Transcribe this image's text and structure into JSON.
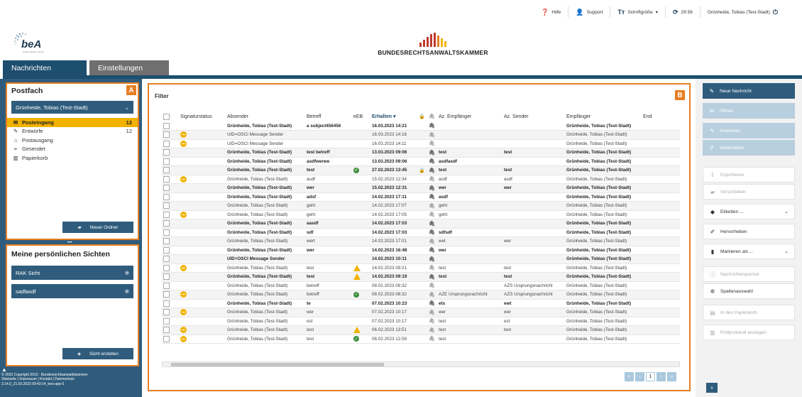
{
  "topbar": {
    "help": "Hilfe",
    "support": "Support",
    "font_size": "Schriftgröße",
    "timer": "29:56",
    "user": "Grünheide, Tobias (Test-Stadt)"
  },
  "logo": {
    "bea": "beA",
    "bea_tagline": "Digital. Einfach. Sicher.",
    "brak": "BUNDESRECHTSANWALTSKAMMER"
  },
  "tabs": [
    {
      "label": "Nachrichten"
    },
    {
      "label": "Einstellungen"
    }
  ],
  "postfach": {
    "title": "Postfach",
    "badge": "A",
    "account": "Grünheide, Tobias (Test-Stadt)",
    "folders": [
      {
        "label": "Posteingang",
        "count": "12",
        "icon": "inbox-icon"
      },
      {
        "label": "Entwürfe",
        "count": "12",
        "icon": "draft-icon"
      },
      {
        "label": "Postausgang",
        "count": "",
        "icon": "outbox-icon"
      },
      {
        "label": "Gesendet",
        "count": "",
        "icon": "sent-icon"
      },
      {
        "label": "Papierkorb",
        "count": "",
        "icon": "trash-icon"
      }
    ],
    "new_folder": "Neuer Ordner"
  },
  "views": {
    "title": "Meine persönlichen Sichten",
    "items": [
      {
        "label": "RAK Sicht"
      },
      {
        "label": "sadfasdf"
      }
    ],
    "create": "Sicht erstellen"
  },
  "footer": {
    "copyright": "© 2023 Copyright 2015 - Bundesrechtsanwaltskammer",
    "links": "Startseite | Impressum | Kontakt | Datenschutz",
    "version": "3.14.0_21.03.2023 09:43:14_bea-app-0"
  },
  "main": {
    "filter": "Filter",
    "badge": "B",
    "columns": [
      "Signaturstatus",
      "Absender",
      "Betreff",
      "eEB",
      "Erhalten",
      "Az. Empfänger",
      "Az. Sender",
      "Empfänger",
      "End"
    ],
    "rows": [
      {
        "status": "",
        "sender": "Grünheide, Tobias (Test-Stadt)",
        "subject": "a subject456456",
        "eeb": "",
        "received": "16.03.2023 14:21",
        "lock": false,
        "az_emp": "",
        "az_snd": "",
        "recipient": "Grünheide, Tobias (Test-Stadt)",
        "unread": true
      },
      {
        "status": "dot",
        "sender": "UID=OSCI Message Sender",
        "subject": "",
        "eeb": "",
        "received": "16.03.2023 14:16",
        "lock": false,
        "az_emp": "",
        "az_snd": "",
        "recipient": "Grünheide, Tobias (Test-Stadt)",
        "unread": false
      },
      {
        "status": "dot",
        "sender": "UID=OSCI Message Sender",
        "subject": "",
        "eeb": "",
        "received": "16.03.2023 14:11",
        "lock": false,
        "az_emp": "",
        "az_snd": "",
        "recipient": "Grünheide, Tobias (Test-Stadt)",
        "unread": false
      },
      {
        "status": "",
        "sender": "Grünheide, Tobias (Test-Stadt)",
        "subject": "test betreff",
        "eeb": "",
        "received": "13.03.2023 09:06",
        "lock": false,
        "az_emp": "test",
        "az_snd": "test",
        "recipient": "Grünheide, Tobias (Test-Stadt)",
        "unread": true
      },
      {
        "status": "",
        "sender": "Grünheide, Tobias (Test-Stadt)",
        "subject": "asdfwerwe",
        "eeb": "",
        "received": "13.03.2023 09:06",
        "lock": false,
        "az_emp": "asdfasdf",
        "az_snd": "",
        "recipient": "Grünheide, Tobias (Test-Stadt)",
        "unread": true
      },
      {
        "status": "",
        "sender": "Grünheide, Tobias (Test-Stadt)",
        "subject": "test",
        "eeb": "ok",
        "received": "27.02.2023 13:45",
        "lock": true,
        "az_emp": "test",
        "az_snd": "test",
        "recipient": "Grünheide, Tobias (Test-Stadt)",
        "unread": true
      },
      {
        "status": "dot",
        "sender": "Grünheide, Tobias (Test-Stadt)",
        "subject": "asdf",
        "eeb": "",
        "received": "15.02.2023 12:34",
        "lock": false,
        "az_emp": "asdf",
        "az_snd": "asdf",
        "recipient": "Grünheide, Tobias (Test-Stadt)",
        "unread": false
      },
      {
        "status": "",
        "sender": "Grünheide, Tobias (Test-Stadt)",
        "subject": "wer",
        "eeb": "",
        "received": "15.02.2023 12:31",
        "lock": false,
        "az_emp": "wer",
        "az_snd": "wer",
        "recipient": "Grünheide, Tobias (Test-Stadt)",
        "unread": true
      },
      {
        "status": "",
        "sender": "Grünheide, Tobias (Test-Stadt)",
        "subject": "adsf",
        "eeb": "",
        "received": "14.02.2023 17:11",
        "lock": false,
        "az_emp": "asdf",
        "az_snd": "",
        "recipient": "Grünheide, Tobias (Test-Stadt)",
        "unread": true
      },
      {
        "status": "",
        "sender": "Grünheide, Tobias (Test-Stadt)",
        "subject": "geht",
        "eeb": "",
        "received": "14.02.2023 17:07",
        "lock": false,
        "az_emp": "geht",
        "az_snd": "",
        "recipient": "Grünheide, Tobias (Test-Stadt)",
        "unread": false
      },
      {
        "status": "dot",
        "sender": "Grünheide, Tobias (Test-Stadt)",
        "subject": "geht",
        "eeb": "",
        "received": "14.02.2023 17:05",
        "lock": false,
        "az_emp": "geht",
        "az_snd": "",
        "recipient": "Grünheide, Tobias (Test-Stadt)",
        "unread": false
      },
      {
        "status": "",
        "sender": "Grünheide, Tobias (Test-Stadt)",
        "subject": "aasdf",
        "eeb": "",
        "received": "14.02.2023 17:03",
        "lock": false,
        "az_emp": "",
        "az_snd": "",
        "recipient": "Grünheide, Tobias (Test-Stadt)",
        "unread": true
      },
      {
        "status": "",
        "sender": "Grünheide, Tobias (Test-Stadt)",
        "subject": "sdf",
        "eeb": "",
        "received": "14.02.2023 17:03",
        "lock": false,
        "az_emp": "sdfsdf",
        "az_snd": "",
        "recipient": "Grünheide, Tobias (Test-Stadt)",
        "unread": true
      },
      {
        "status": "",
        "sender": "Grünheide, Tobias (Test-Stadt)",
        "subject": "wert",
        "eeb": "",
        "received": "14.02.2023 17:01",
        "lock": false,
        "az_emp": "wet",
        "az_snd": "wer",
        "recipient": "Grünheide, Tobias (Test-Stadt)",
        "unread": false
      },
      {
        "status": "",
        "sender": "Grünheide, Tobias (Test-Stadt)",
        "subject": "wer",
        "eeb": "",
        "received": "14.02.2023 16:48",
        "lock": false,
        "az_emp": "wer",
        "az_snd": "",
        "recipient": "Grünheide, Tobias (Test-Stadt)",
        "unread": true
      },
      {
        "status": "",
        "sender": "UID=OSCI Message Sender",
        "subject": "",
        "eeb": "",
        "received": "14.02.2023 10:11",
        "lock": false,
        "az_emp": "",
        "az_snd": "",
        "recipient": "Grünheide, Tobias (Test-Stadt)",
        "unread": true
      },
      {
        "status": "dot",
        "sender": "Grünheide, Tobias (Test-Stadt)",
        "subject": "test",
        "eeb": "warn",
        "received": "14.02.2023 09:21",
        "lock": false,
        "az_emp": "test",
        "az_snd": "test",
        "recipient": "Grünheide, Tobias (Test-Stadt)",
        "unread": false
      },
      {
        "status": "",
        "sender": "Grünheide, Tobias (Test-Stadt)",
        "subject": "test",
        "eeb": "warn",
        "received": "14.02.2023 09:19",
        "lock": false,
        "az_emp": "test",
        "az_snd": "test",
        "recipient": "Grünheide, Tobias (Test-Stadt)",
        "unread": true
      },
      {
        "status": "",
        "sender": "Grünheide, Tobias (Test-Stadt)",
        "subject": "betreff",
        "eeb": "",
        "received": "08.02.2023 08:32",
        "lock": false,
        "az_emp": "",
        "az_snd": "AZS Ursprungsnachricht",
        "recipient": "Grünheide, Tobias (Test-Stadt)",
        "unread": false
      },
      {
        "status": "dot",
        "sender": "Grünheide, Tobias (Test-Stadt)",
        "subject": "betreff",
        "eeb": "ok",
        "received": "08.02.2023 08:32",
        "lock": false,
        "az_emp": "AZE Ursprungsnachricht",
        "az_snd": "AZS Ursprungsnachricht",
        "recipient": "Grünheide, Tobias (Test-Stadt)",
        "unread": false
      },
      {
        "status": "",
        "sender": "Grünheide, Tobias (Test-Stadt)",
        "subject": "te",
        "eeb": "",
        "received": "07.02.2023 10:23",
        "lock": false,
        "az_emp": "ets",
        "az_snd": "ewt",
        "recipient": "Grünheide, Tobias (Test-Stadt)",
        "unread": true
      },
      {
        "status": "dot",
        "sender": "Grünheide, Tobias (Test-Stadt)",
        "subject": "wer",
        "eeb": "",
        "received": "07.02.2023 10:17",
        "lock": false,
        "az_emp": "wer",
        "az_snd": "wer",
        "recipient": "Grünheide, Tobias (Test-Stadt)",
        "unread": false
      },
      {
        "status": "",
        "sender": "Grünheide, Tobias (Test-Stadt)",
        "subject": "est",
        "eeb": "",
        "received": "07.02.2023 10:17",
        "lock": false,
        "az_emp": "test",
        "az_snd": "est",
        "recipient": "Grünheide, Tobias (Test-Stadt)",
        "unread": false
      },
      {
        "status": "dot",
        "sender": "Grünheide, Tobias (Test-Stadt)",
        "subject": "test",
        "eeb": "warn",
        "received": "06.02.2023 13:51",
        "lock": false,
        "az_emp": "test",
        "az_snd": "test",
        "recipient": "Grünheide, Tobias (Test-Stadt)",
        "unread": false
      },
      {
        "status": "dot",
        "sender": "Grünheide, Tobias (Test-Stadt)",
        "subject": "test",
        "eeb": "ok",
        "received": "06.02.2023 12:59",
        "lock": false,
        "az_emp": "test",
        "az_snd": "",
        "recipient": "Grünheide, Tobias (Test-Stadt)",
        "unread": false
      }
    ],
    "pager": {
      "first": "«",
      "prev": "‹",
      "current": "1",
      "next": "›",
      "last": "»"
    }
  },
  "actions": [
    {
      "label": "Neue Nachricht",
      "style": "dark",
      "icon": "pencil-icon",
      "glyph": "✎"
    },
    {
      "label": "Öffnen",
      "style": "light",
      "icon": "envelope-icon",
      "glyph": "✉"
    },
    {
      "label": "Antworten",
      "style": "light",
      "icon": "reply-icon",
      "glyph": "↰"
    },
    {
      "label": "Weiterleiten",
      "style": "light",
      "icon": "forward-icon",
      "glyph": "↱"
    },
    {
      "label": "Exportieren",
      "style": "white-dis",
      "icon": "export-icon",
      "glyph": "⇩"
    },
    {
      "label": "Verschieben",
      "style": "white-dis",
      "icon": "folder-icon",
      "glyph": "▰"
    },
    {
      "label": "Etiketten ...",
      "style": "white",
      "icon": "tag-icon",
      "glyph": "◆",
      "chevron": true
    },
    {
      "label": "Hervorheben",
      "style": "white",
      "icon": "highlight-icon",
      "glyph": "✐"
    },
    {
      "label": "Markieren als ...",
      "style": "white",
      "icon": "bookmark-icon",
      "glyph": "▮",
      "chevron": true
    },
    {
      "label": "Nachrichtenjournal",
      "style": "white-dis",
      "icon": "info-icon",
      "glyph": "ⓘ"
    },
    {
      "label": "Spaltenauswahl",
      "style": "white",
      "icon": "gear-icon",
      "glyph": "✲"
    },
    {
      "label": "In den Papierkorb",
      "style": "white-dis",
      "icon": "trash-icon",
      "glyph": "▤"
    },
    {
      "label": "Prüfprotokoll anzeigen",
      "style": "white-dis",
      "icon": "document-icon",
      "glyph": "▥"
    }
  ],
  "colors": {
    "brand_dark": "#1d4e6e",
    "sidebar": "#2f5c7c",
    "highlight": "#e67e22",
    "active_folder": "#f1b200"
  }
}
